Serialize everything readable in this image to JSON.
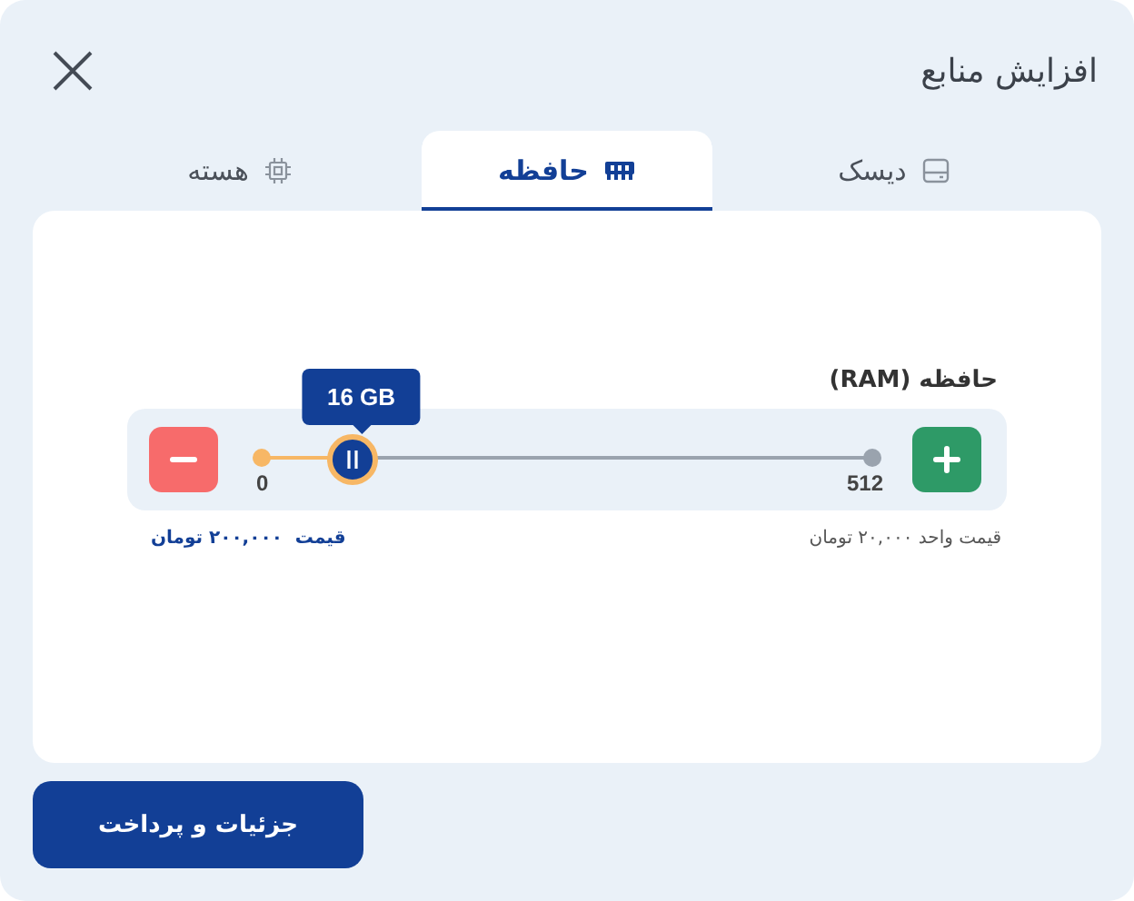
{
  "window": {
    "title": "افزایش منابع"
  },
  "tabs": [
    {
      "label": "دیسک",
      "kind": "disk",
      "selected": false
    },
    {
      "label": "حافظه",
      "kind": "memory",
      "selected": true
    },
    {
      "label": "هسته",
      "kind": "chip",
      "selected": false
    }
  ],
  "resource": {
    "label": "حافظه (RAM)",
    "min": "0",
    "max": "512",
    "value": "16 GB",
    "level": 0.16,
    "unit_price": "قیمت واحد ۲۰,۰۰۰ تومان",
    "price": "قیمت  ۲۰۰,۰۰۰ تومان"
  },
  "buttons": [
    {
      "label": "جزئیات و پرداخت"
    }
  ]
}
